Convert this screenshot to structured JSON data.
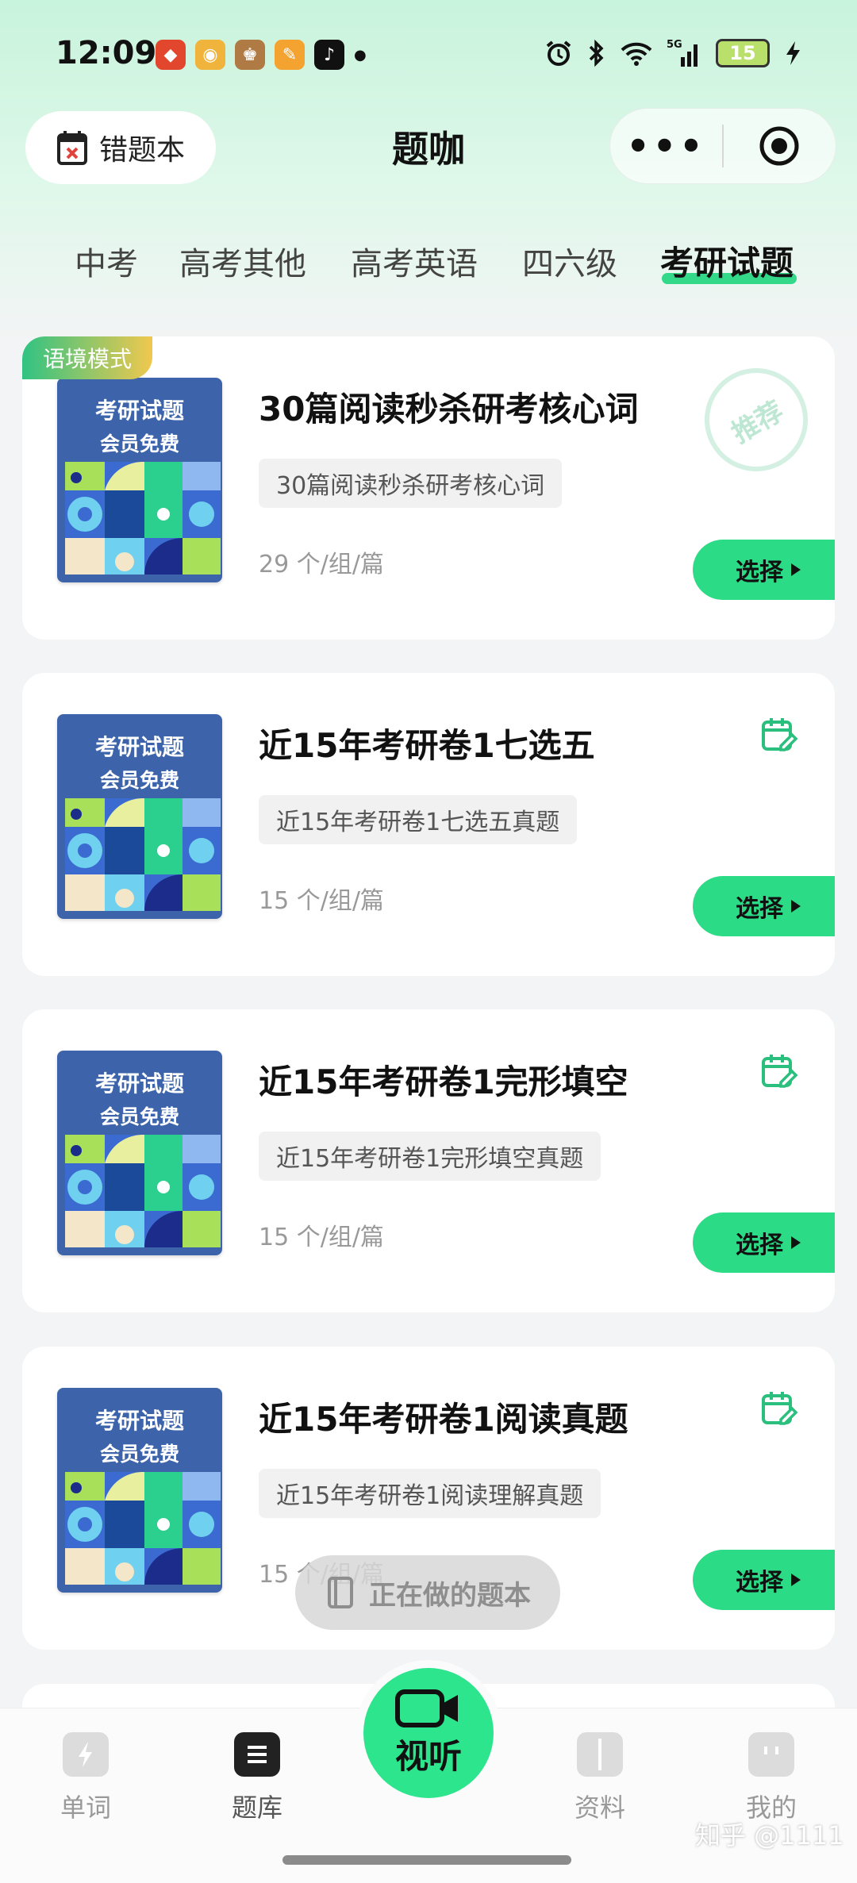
{
  "status_bar": {
    "time": "12:09",
    "battery": "15",
    "network": "5G",
    "icons": [
      "alarm-icon",
      "bluetooth-icon",
      "wifi-icon",
      "signal-icon",
      "charging-icon"
    ]
  },
  "header": {
    "wrong_book_label": "错题本",
    "title": "题咖",
    "more_label": "•••"
  },
  "tabs": [
    {
      "label": "中考",
      "active": false
    },
    {
      "label": "高考其他",
      "active": false
    },
    {
      "label": "高考英语",
      "active": false
    },
    {
      "label": "四六级",
      "active": false
    },
    {
      "label": "考研试题",
      "active": true
    }
  ],
  "cards": [
    {
      "badge": "语境模式",
      "cover_title": "考研试题",
      "cover_subtitle": "会员免费",
      "title": "30篇阅读秒杀研考核心词",
      "tag": "30篇阅读秒杀研考核心词",
      "count": "29 个/组/篇",
      "stamp": "推荐",
      "select_label": "选择"
    },
    {
      "cover_title": "考研试题",
      "cover_subtitle": "会员免费",
      "title": "近15年考研卷1七选五",
      "tag": "近15年考研卷1七选五真题",
      "count": "15 个/组/篇",
      "select_label": "选择"
    },
    {
      "cover_title": "考研试题",
      "cover_subtitle": "会员免费",
      "title": "近15年考研卷1完形填空",
      "tag": "近15年考研卷1完形填空真题",
      "count": "15 个/组/篇",
      "select_label": "选择"
    },
    {
      "cover_title": "考研试题",
      "cover_subtitle": "会员免费",
      "title": "近15年考研卷1阅读真题",
      "tag": "近15年考研卷1阅读理解真题",
      "count": "15 个/组/篇",
      "select_label": "选择"
    }
  ],
  "floating": {
    "doing_label": "正在做的题本"
  },
  "bottom_nav": {
    "items": [
      {
        "label": "单词"
      },
      {
        "label": "题库"
      },
      {
        "label": "视听"
      },
      {
        "label": "资料"
      },
      {
        "label": "我的"
      }
    ]
  },
  "watermark": "知乎 @1111",
  "colors": {
    "accent": "#2bdb86",
    "cover": "#3d64ab",
    "background": "#f3f4f5"
  }
}
